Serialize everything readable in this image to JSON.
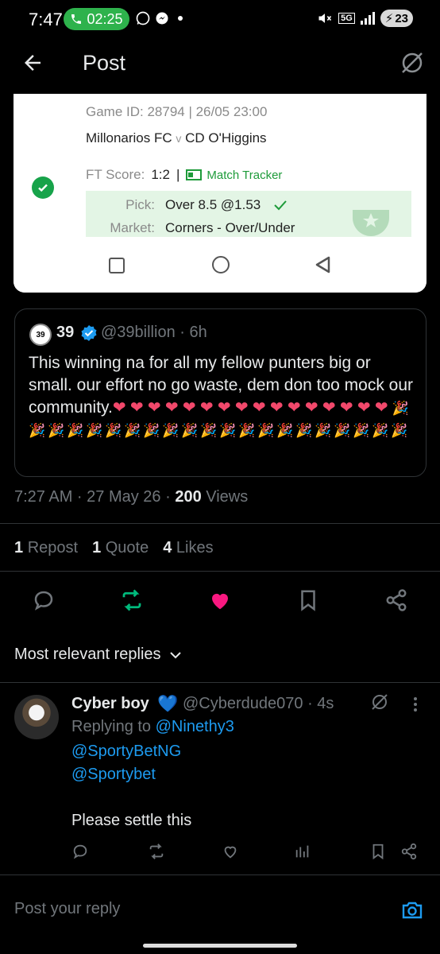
{
  "status_bar": {
    "time": "7:47",
    "call_timer": "02:25",
    "network": "5G",
    "battery": "23"
  },
  "header": {
    "title": "Post"
  },
  "embedded_screenshot": {
    "game_id": "Game ID: 28794 | 26/05 23:00",
    "home_team": "Millonarios FC",
    "versus": "v",
    "away_team": "CD O'Higgins",
    "ft_score_label": "FT Score:",
    "ft_score": "1:2",
    "separator": "|",
    "match_tracker": "Match Tracker",
    "pick_label": "Pick:",
    "pick_value": "Over 8.5 @1.53",
    "market_label": "Market:",
    "market_value": "Corners - Over/Under"
  },
  "quote": {
    "avatar_text": "39",
    "name": "39",
    "handle": "@39billion · 6h",
    "text": "This winning na for all my fellow punters big or small. our effort no go waste, dem don too mock our community.",
    "hearts": 16,
    "parties": 21
  },
  "meta": {
    "time": "7:27 AM · 27 May 26 · ",
    "views_count": "200",
    "views_label": " Views"
  },
  "stats": {
    "reposts_count": "1",
    "reposts_label": "Repost",
    "quotes_count": "1",
    "quotes_label": "Quote",
    "likes_count": "4",
    "likes_label": "Likes"
  },
  "colors": {
    "repost_active": "#00ba7c",
    "like_active": "#f91880",
    "link": "#1d9bf0",
    "verified": "#1d9bf0"
  },
  "replies_filter": "Most relevant replies",
  "reply": {
    "name": "Cyber boy",
    "handle": "@Cyberdude070 · 4s",
    "replying_prefix": "Replying to ",
    "replying_to": "@Ninethy3",
    "mention1": "@SportyBetNG",
    "mention2": "@Sportybet",
    "body": "Please settle this"
  },
  "composer": {
    "placeholder": "Post your reply"
  }
}
